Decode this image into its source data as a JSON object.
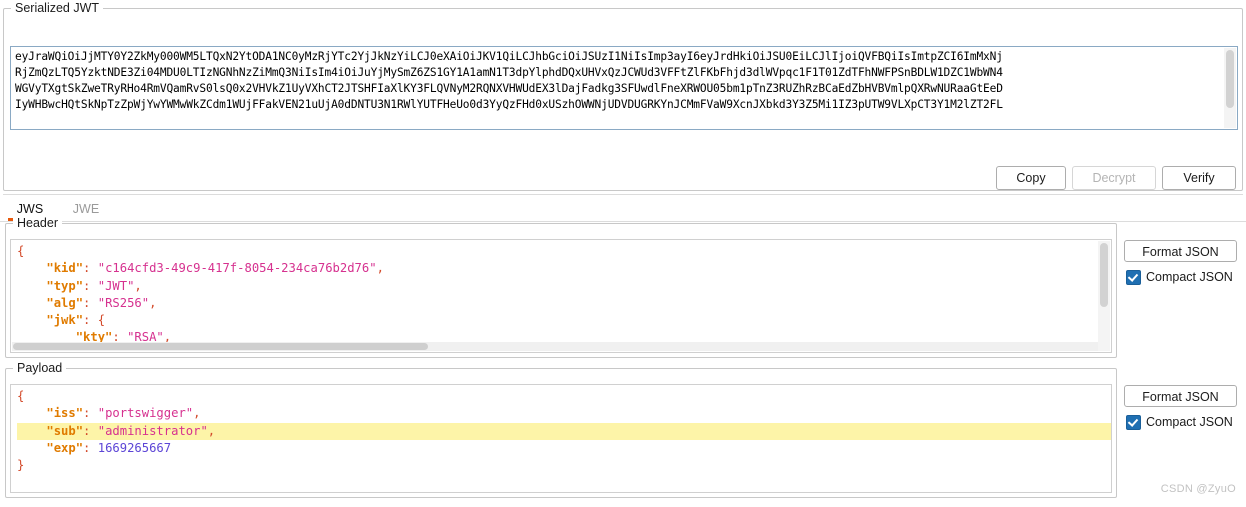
{
  "serialized": {
    "group_title": "Serialized JWT",
    "jwt_lines": [
      "eyJraWQiOiJjMTY0Y2ZkMy000WM5LTQxN2YtODA1NC0yMzRjYTc2YjJkNzYiLCJ0eXAiOiJKV1QiLCJhbGciOiJSUzI1NiIsImp3ayI6eyJrdHkiOiJSU0EiLCJlIjoiQVFBQiIsImtpZCI6ImMxNj",
      "RjZmQzLTQ5YzktNDE3Zi04MDU0LTIzNGNhNzZiMmQ3NiIsIm4iOiJuYjMySmZ6ZS1GY1A1amN1T3dpYlphdDQxUHVxQzJCWUd3VFFtZlFKbFhjd3dlWVpqc1F1T01ZdTFhNWFPSnBDLW1DZC1WbWN4",
      "WGVyTXgtSkZweTRyRHo4RmVQamRvS0lsQ0x2VHVkZ1UyVXhCT2JTSHFIaXlKY3FLQVNyM2RQNXVHWUdEX3lDajFadkg3SFUwdlFneXRWOU05bm1pTnZ3RUZhRzBCaEdZbHVBVmlpQXRwNURaaGtEeD",
      "IyWHBwcHQtSkNpTzZpWjYwYWMwWkZCdm1WUjFFakVEN21uUjA0dDNTU3N1RWlYUTFHeUo0d3YyQzFHd0xUSzhOWWNjUDVDUGRKYnJCMmFVaW9XcnJXbkd3Y3Z5Mi1IZ3pUTW9VLXpCT3Y1M2lZT2FL"
    ]
  },
  "actions": {
    "copy_label": "Copy",
    "decrypt_label": "Decrypt",
    "verify_label": "Verify"
  },
  "tabs": [
    {
      "label": "JWS",
      "active": true
    },
    {
      "label": "JWE",
      "active": false
    }
  ],
  "header_panel": {
    "group_title": "Header",
    "format_button": "Format JSON",
    "compact_label": "Compact JSON",
    "compact_checked": true,
    "lines": [
      {
        "indent": 0,
        "type": "brace_open",
        "text": "{"
      },
      {
        "indent": 1,
        "type": "kv_string",
        "key": "kid",
        "value": "c164cfd3-49c9-417f-8054-234ca76b2d76",
        "trailing": ","
      },
      {
        "indent": 1,
        "type": "kv_string",
        "key": "typ",
        "value": "JWT",
        "trailing": ","
      },
      {
        "indent": 1,
        "type": "kv_string",
        "key": "alg",
        "value": "RS256",
        "trailing": ","
      },
      {
        "indent": 1,
        "type": "kv_object",
        "key": "jwk",
        "value": "{",
        "trailing": ""
      },
      {
        "indent": 2,
        "type": "kv_string",
        "key": "kty",
        "value": "RSA",
        "trailing": ","
      }
    ]
  },
  "payload_panel": {
    "group_title": "Payload",
    "format_button": "Format JSON",
    "compact_label": "Compact JSON",
    "compact_checked": true,
    "lines": [
      {
        "indent": 0,
        "type": "brace_open",
        "text": "{"
      },
      {
        "indent": 1,
        "type": "kv_string",
        "key": "iss",
        "value": "portswigger",
        "trailing": ","
      },
      {
        "indent": 1,
        "type": "kv_string",
        "key": "sub",
        "value": "administrator",
        "trailing": ",",
        "highlight": true
      },
      {
        "indent": 1,
        "type": "kv_number",
        "key": "exp",
        "value": "1669265667",
        "trailing": ""
      },
      {
        "indent": 0,
        "type": "brace_close",
        "text": "}"
      }
    ]
  },
  "watermark": "CSDN @ZyuO"
}
